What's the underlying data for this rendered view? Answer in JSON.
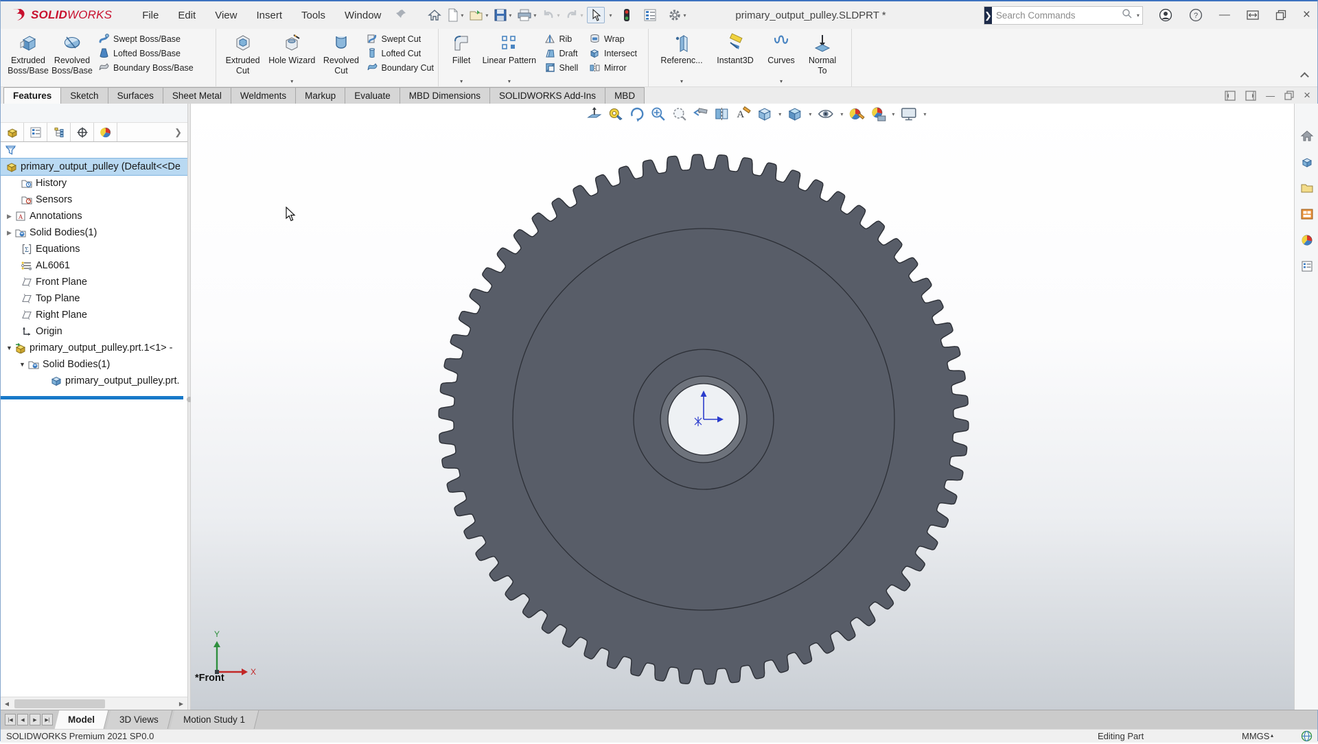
{
  "window": {
    "brand": {
      "bold": "SOLID",
      "light": "WORKS"
    },
    "menus": [
      "File",
      "Edit",
      "View",
      "Insert",
      "Tools",
      "Window"
    ],
    "title": "primary_output_pulley.SLDPRT *",
    "search": {
      "placeholder": "Search Commands"
    }
  },
  "ribbon": {
    "g1": {
      "b1": "Extruded\nBoss/Base",
      "b2": "Revolved\nBoss/Base",
      "s1": "Swept Boss/Base",
      "s2": "Lofted Boss/Base",
      "s3": "Boundary Boss/Base"
    },
    "g2": {
      "b1": "Extruded\nCut",
      "b2": "Hole Wizard",
      "b3": "Revolved\nCut",
      "s1": "Swept Cut",
      "s2": "Lofted Cut",
      "s3": "Boundary Cut"
    },
    "g3": {
      "b1": "Fillet",
      "b2": "Linear Pattern",
      "s1": "Rib",
      "s2": "Draft",
      "s3": "Shell",
      "t1": "Wrap",
      "t2": "Intersect",
      "t3": "Mirror"
    },
    "g4": {
      "b1": "Referenc...",
      "b2": "Instant3D",
      "b3": "Curves",
      "b4": "Normal\nTo"
    },
    "tabs": [
      "Features",
      "Sketch",
      "Surfaces",
      "Sheet Metal",
      "Weldments",
      "Markup",
      "Evaluate",
      "MBD Dimensions",
      "SOLIDWORKS Add-Ins",
      "MBD"
    ]
  },
  "feature_tree": {
    "root": "primary_output_pulley  (Default<<De",
    "items": [
      "History",
      "Sensors",
      "Annotations",
      "Solid Bodies(1)",
      "Equations",
      "AL6061",
      "Front Plane",
      "Top Plane",
      "Right Plane",
      "Origin",
      "primary_output_pulley.prt.1<1> -",
      "Solid Bodies(1)",
      "primary_output_pulley.prt."
    ]
  },
  "viewport": {
    "view_label": "*Front",
    "axes": {
      "x": "X",
      "y": "Y"
    },
    "model": {
      "teeth": 66,
      "tip_radius": 386,
      "root_radius": 364,
      "rim_radius": 278,
      "hub_radius": 102,
      "bore_outer_radius": 63,
      "bore_radius": 52,
      "body_color": "#585d68",
      "chamfer_color": "#6e737c",
      "edge_color": "#2c2f36",
      "bore_fill": "#eef1f4",
      "origin_color": "#2a3ccc"
    }
  },
  "bottom_tabs": [
    "Model",
    "3D Views",
    "Motion Study 1"
  ],
  "status_bar": {
    "left": "SOLIDWORKS Premium 2021 SP0.0",
    "mode": "Editing Part",
    "units": "MMGS"
  }
}
